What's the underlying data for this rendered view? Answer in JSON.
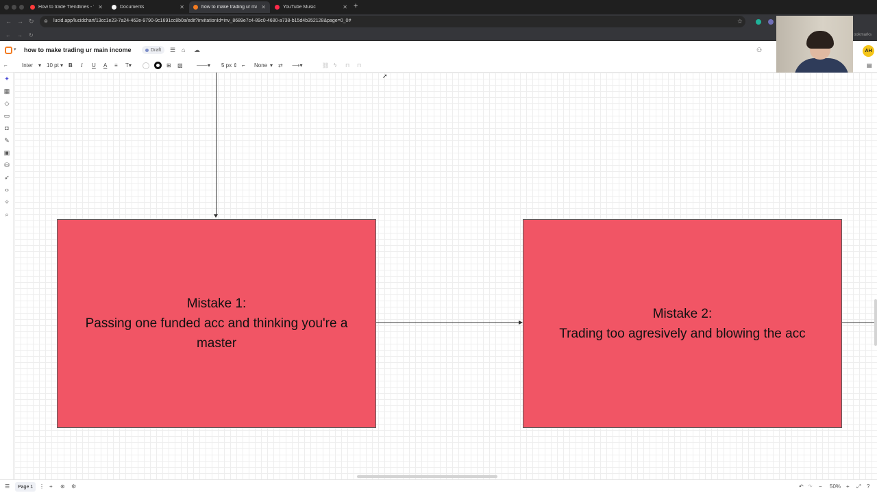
{
  "browser": {
    "tabs": [
      {
        "title": "How to trade Trendlines - You",
        "favicon_color": "#ff3b3b",
        "active": false
      },
      {
        "title": "Documents",
        "favicon_color": "#f5f5f5",
        "active": false
      },
      {
        "title": "how to make trading ur main",
        "favicon_color": "#f37b21",
        "active": true
      },
      {
        "title": "YouTube Music",
        "favicon_color": "#ff2a4a",
        "active": false
      }
    ],
    "url": "lucid.app/lucidchart/13cc1e23-7a24-462e-9790-9c1691cc8b0a/edit?invitationId=inv_8689e7c4-89c0-4680-a738-b15d4b352128&page=0_0#",
    "bookmarks_label": "ookmarks"
  },
  "app": {
    "doc_title": "how to make trading ur main income",
    "draft_label": "Draft",
    "avatar_initials": "AH",
    "accent_color": "#f37b21"
  },
  "toolbar": {
    "font": "Inter",
    "font_size": "10 pt",
    "bold": "B",
    "italic": "I",
    "underline": "U",
    "text_color": "A",
    "line_width": "5 px",
    "endpoint": "None"
  },
  "canvas": {
    "shape_color": "#f15565",
    "shapes": [
      {
        "text": "Mistake 1:\nPassing one funded acc and thinking you're a master"
      },
      {
        "text": "Mistake 2:\nTrading too agresively and blowing the acc"
      }
    ]
  },
  "bottombar": {
    "page_label": "Page 1",
    "zoom": "50%"
  }
}
